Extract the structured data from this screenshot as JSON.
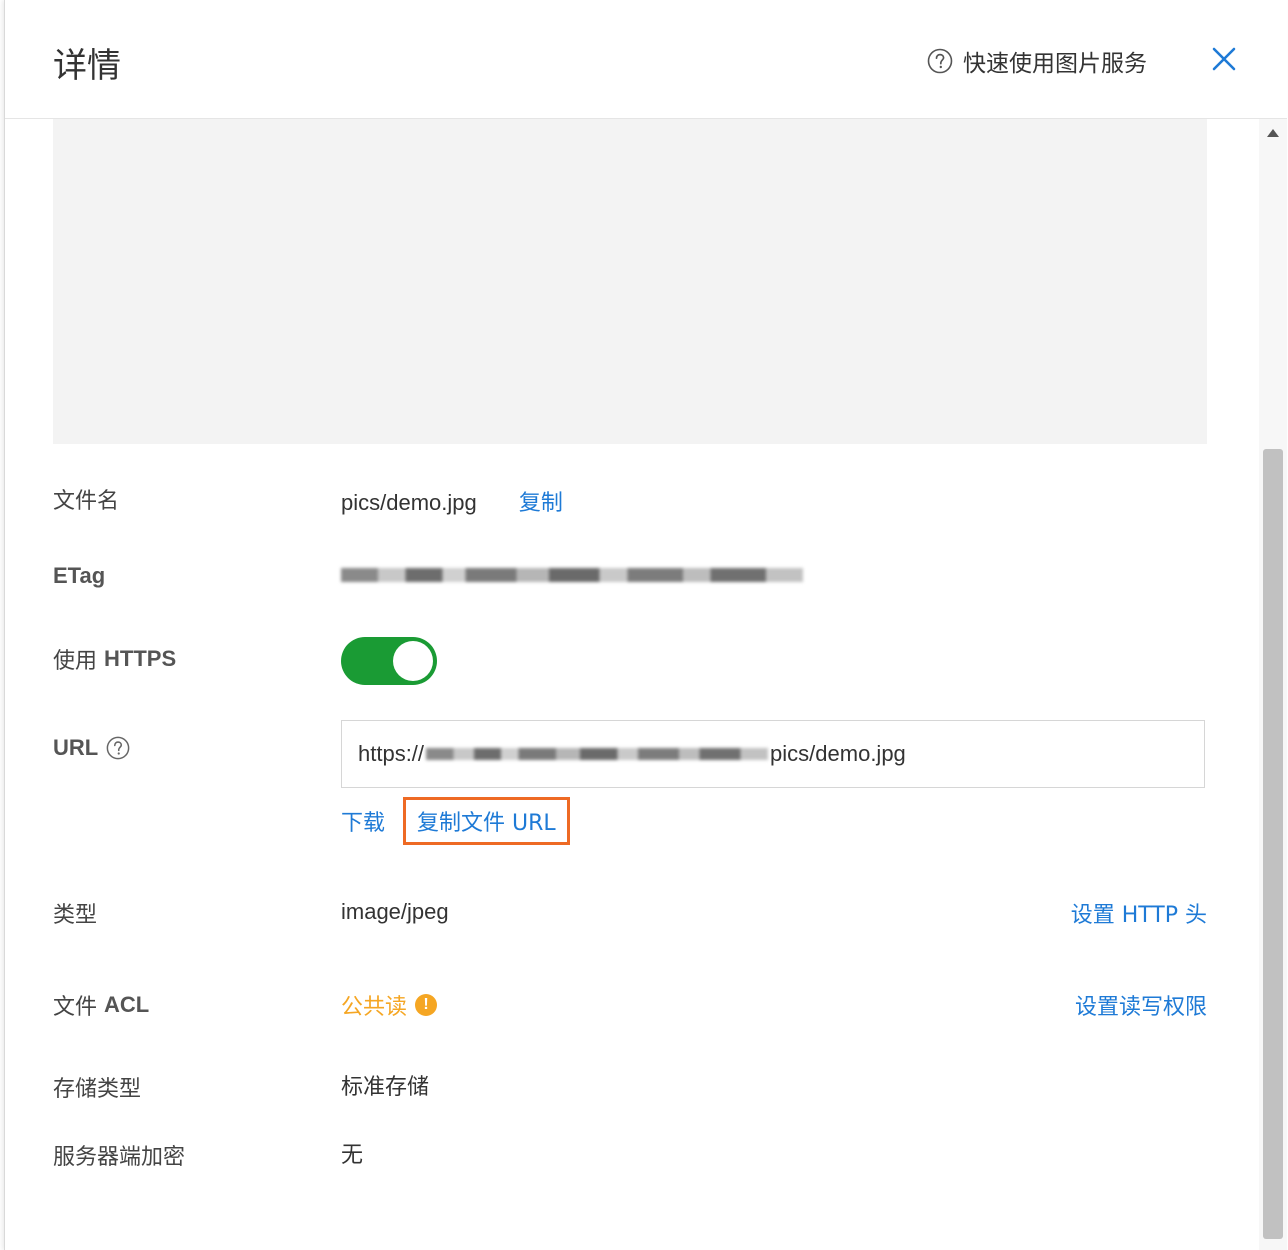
{
  "header": {
    "title": "详情",
    "help_label": "快速使用图片服务",
    "help_icon": "question-circle-icon",
    "close_icon": "close-icon"
  },
  "details": {
    "filename": {
      "label": "文件名",
      "value": "pics/demo.jpg",
      "copy": "复制"
    },
    "etag": {
      "label": "ETag"
    },
    "https": {
      "label_cn": "使用",
      "label_en": "HTTPS",
      "enabled": true
    },
    "url": {
      "label": "URL",
      "value_prefix": "https://",
      "value_suffix": "pics/demo.jpg",
      "download": "下载",
      "copy_url": "复制文件 URL"
    },
    "type": {
      "label": "类型",
      "value": "image/jpeg",
      "action": "设置 HTTP 头"
    },
    "acl": {
      "label_cn": "文件",
      "label_en": "ACL",
      "value": "公共读",
      "action": "设置读写权限"
    },
    "storage": {
      "label": "存储类型",
      "value": "标准存储"
    },
    "encryption": {
      "label": "服务器端加密",
      "value": "无"
    }
  },
  "colors": {
    "link": "#1e7ad6",
    "toggle_on": "#1a9b34",
    "warning": "#f5a623",
    "highlight": "#ee6a24"
  }
}
